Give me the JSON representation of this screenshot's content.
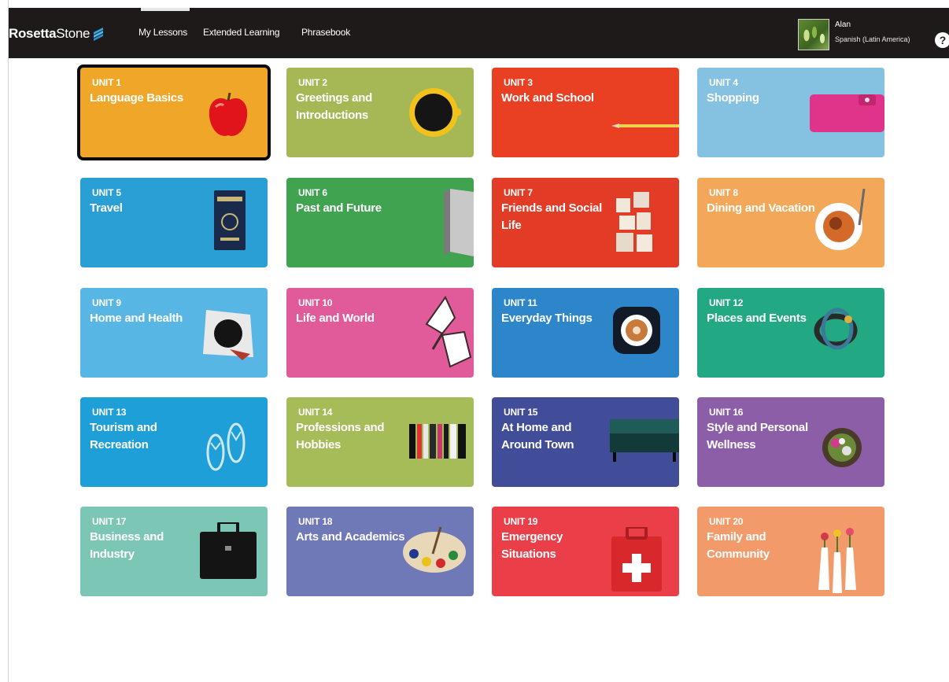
{
  "app": {
    "brand": {
      "name_bold": "Rosetta",
      "name_rest": "Stone"
    },
    "nav": [
      {
        "label": "My Lessons",
        "active": true
      },
      {
        "label": "Extended Learning",
        "active": false
      },
      {
        "label": "Phrasebook",
        "active": false
      }
    ],
    "user": {
      "name": "Alan",
      "course": "Spanish (Latin America)"
    },
    "help_label": "?"
  },
  "units": [
    {
      "label": "UNIT 1",
      "title": "Language Basics",
      "color": "#f0a628",
      "icon": "apple-icon",
      "selected": true
    },
    {
      "label": "UNIT 2",
      "title": "Greetings and Introductions",
      "color": "#a6b855",
      "icon": "coffee-cup-icon"
    },
    {
      "label": "UNIT 3",
      "title": "Work and School",
      "color": "#e93f23",
      "icon": "pencil-icon"
    },
    {
      "label": "UNIT 4",
      "title": "Shopping",
      "color": "#85c1e0",
      "icon": "wallet-icon"
    },
    {
      "label": "UNIT 5",
      "title": "Travel",
      "color": "#2a9fd6",
      "icon": "passport-icon"
    },
    {
      "label": "UNIT 6",
      "title": "Past and Future",
      "color": "#3fa350",
      "icon": "laptop-icon"
    },
    {
      "label": "UNIT 7",
      "title": "Friends and Social Life",
      "color": "#e33c26",
      "icon": "blocks-icon"
    },
    {
      "label": "UNIT 8",
      "title": "Dining and Vacation",
      "color": "#f3a759",
      "icon": "plate-icon"
    },
    {
      "label": "UNIT 9",
      "title": "Home and Health",
      "color": "#58b6e5",
      "icon": "mug-icon"
    },
    {
      "label": "UNIT 10",
      "title": "Life and World",
      "color": "#e15b9b",
      "icon": "butterfly-icon"
    },
    {
      "label": "UNIT 11",
      "title": "Everyday Things",
      "color": "#2d86c9",
      "icon": "latte-icon"
    },
    {
      "label": "UNIT 12",
      "title": "Places and Events",
      "color": "#23a884",
      "icon": "bracelet-icon"
    },
    {
      "label": "UNIT 13",
      "title": "Tourism and Recreation",
      "color": "#1f9fd8",
      "icon": "flip-flops-icon"
    },
    {
      "label": "UNIT 14",
      "title": "Professions and Hobbies",
      "color": "#a5bc59",
      "icon": "books-icon"
    },
    {
      "label": "UNIT 15",
      "title": "At Home and Around Town",
      "color": "#414d99",
      "icon": "sofa-icon"
    },
    {
      "label": "UNIT 16",
      "title": "Style and Personal Wellness",
      "color": "#8d5ea8",
      "icon": "flower-icon"
    },
    {
      "label": "UNIT 17",
      "title": "Business and Industry",
      "color": "#7cc6b6",
      "icon": "briefcase-icon"
    },
    {
      "label": "UNIT 18",
      "title": "Arts and Academics",
      "color": "#6f79b8",
      "icon": "palette-icon"
    },
    {
      "label": "UNIT 19",
      "title": "Emergency Situations",
      "color": "#ea3f48",
      "icon": "first-aid-icon"
    },
    {
      "label": "UNIT 20",
      "title": "Family and Community",
      "color": "#f39a6a",
      "icon": "vases-icon"
    }
  ]
}
